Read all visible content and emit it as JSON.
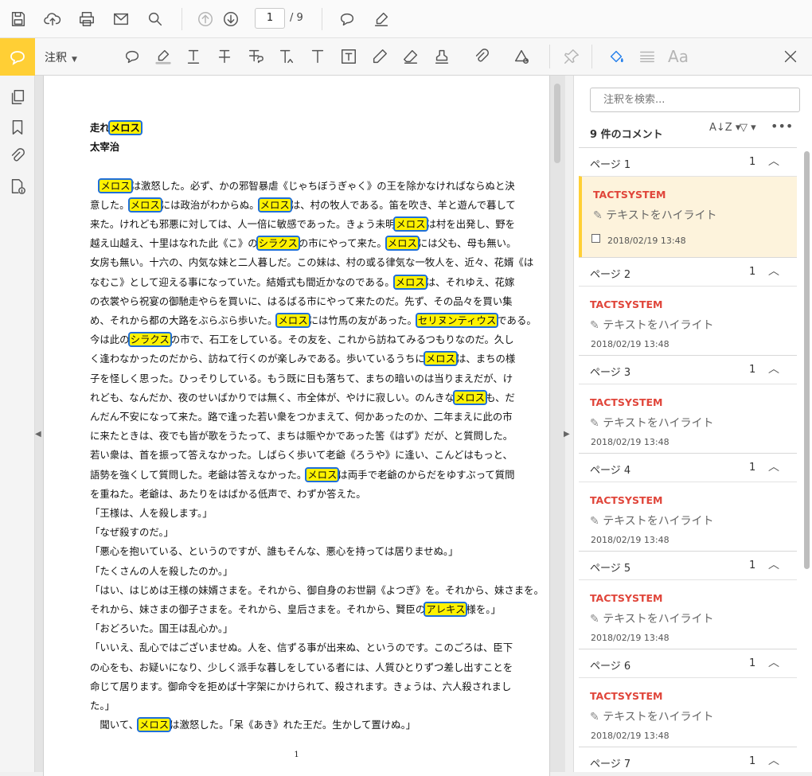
{
  "toolbar": {
    "page_current": "1",
    "page_total": "/ 9",
    "icons": [
      "save-icon",
      "upload-icon",
      "print-icon",
      "email-icon",
      "search-icon",
      "prev-page-icon",
      "next-page-icon",
      "comment-icon",
      "sign-icon"
    ]
  },
  "annot_toolbar": {
    "label": "注釈",
    "icons": [
      "sticky-note-icon",
      "highlight-icon",
      "underline-icon",
      "strikethrough-icon",
      "replace-text-icon",
      "insert-text-icon",
      "add-text-icon",
      "textbox-icon",
      "pencil-icon",
      "eraser-icon",
      "stamp-icon",
      "attach-icon",
      "shapes-icon",
      "pin-icon",
      "fill-color-icon",
      "line-weight-icon"
    ],
    "font_label": "Aa"
  },
  "document": {
    "title_lines": [
      {
        "before": "走れ",
        "hl": "メロス",
        "after": ""
      },
      {
        "before": "太宰治",
        "hl": "",
        "after": ""
      }
    ],
    "page_number": "1"
  },
  "right_panel": {
    "search_placeholder": "注釈を検索...",
    "comment_count": "9 件のコメント",
    "groups": [
      {
        "title": "ページ 1",
        "count": "1",
        "author": "TACTSYSTEM",
        "action": "テキストをハイライト",
        "date": "2018/02/19 13:48",
        "selected": true
      },
      {
        "title": "ページ 2",
        "count": "1",
        "author": "TACTSYSTEM",
        "action": "テキストをハイライト",
        "date": "2018/02/19 13:48",
        "selected": false
      },
      {
        "title": "ページ 3",
        "count": "1",
        "author": "TACTSYSTEM",
        "action": "テキストをハイライト",
        "date": "2018/02/19 13:48",
        "selected": false
      },
      {
        "title": "ページ 4",
        "count": "1",
        "author": "TACTSYSTEM",
        "action": "テキストをハイライト",
        "date": "2018/02/19 13:48",
        "selected": false
      },
      {
        "title": "ページ 5",
        "count": "1",
        "author": "TACTSYSTEM",
        "action": "テキストをハイライト",
        "date": "2018/02/19 13:48",
        "selected": false
      },
      {
        "title": "ページ 6",
        "count": "1",
        "author": "TACTSYSTEM",
        "action": "テキストをハイライト",
        "date": "2018/02/19 13:48",
        "selected": false
      },
      {
        "title": "ページ 7",
        "count": "1",
        "author": "",
        "action": "",
        "date": "",
        "selected": false
      }
    ]
  },
  "body_lines": [
    {
      "cls": "p",
      "segs": [
        [
          "　",
          ""
        ],
        [
          "メロス",
          "hl"
        ],
        [
          "は激怒した。必ず、かの邪智暴虐《じゃちぼうぎゃく》の王を除かなければならぬと決",
          ""
        ]
      ]
    },
    {
      "cls": "p",
      "segs": [
        [
          "意した。",
          ""
        ],
        [
          "メロス",
          "hl"
        ],
        [
          "には政治がわからぬ。",
          ""
        ],
        [
          "メロス",
          "hl"
        ],
        [
          "は、村の牧人である。笛を吹き、羊と遊んで暮して",
          ""
        ]
      ]
    },
    {
      "cls": "p",
      "segs": [
        [
          "来た。けれども邪悪に対しては、人一倍に敏感であった。きょう未明",
          ""
        ],
        [
          "メロス",
          "hl"
        ],
        [
          "は村を出発し、野を",
          ""
        ]
      ]
    },
    {
      "cls": "p",
      "segs": [
        [
          "越え山越え、十里はなれた此《こ》の",
          ""
        ],
        [
          "シラクス",
          "hl"
        ],
        [
          "の市にやって来た。",
          ""
        ],
        [
          "メロス",
          "hl"
        ],
        [
          "には父も、母も無い。",
          ""
        ]
      ]
    },
    {
      "cls": "p",
      "segs": [
        [
          "女房も無い。十六の、内気な妹と二人暮しだ。この妹は、村の或る律気な一牧人を、近々、花婿《は",
          ""
        ]
      ]
    },
    {
      "cls": "p",
      "segs": [
        [
          "なむこ》として迎える事になっていた。結婚式も間近かなのである。",
          ""
        ],
        [
          "メロス",
          "hl"
        ],
        [
          "は、それゆえ、花嫁",
          ""
        ]
      ]
    },
    {
      "cls": "p",
      "segs": [
        [
          "の衣裳やら祝宴の御馳走やらを買いに、はるばる市にやって来たのだ。先ず、その品々を買い集",
          ""
        ]
      ]
    },
    {
      "cls": "p",
      "segs": [
        [
          "め、それから都の大路をぶらぶら歩いた。",
          ""
        ],
        [
          "メロス",
          "hl"
        ],
        [
          "には竹馬の友があった。",
          ""
        ],
        [
          "セリヌンティウス",
          "hl"
        ],
        [
          "である。",
          ""
        ]
      ]
    },
    {
      "cls": "p",
      "segs": [
        [
          "今は此の",
          ""
        ],
        [
          "シラクス",
          "hl"
        ],
        [
          "の市で、石工をしている。その友を、これから訪ねてみるつもりなのだ。久し",
          ""
        ]
      ]
    },
    {
      "cls": "p",
      "segs": [
        [
          "く逢わなかったのだから、訪ねて行くのが楽しみである。歩いているうちに",
          ""
        ],
        [
          "メロス",
          "hl"
        ],
        [
          "は、まちの様",
          ""
        ]
      ]
    },
    {
      "cls": "p",
      "segs": [
        [
          "子を怪しく思った。ひっそりしている。もう既に日も落ちて、まちの暗いのは当りまえだが、け",
          ""
        ]
      ]
    },
    {
      "cls": "p",
      "segs": [
        [
          "れども、なんだか、夜のせいばかりでは無く、市全体が、やけに寂しい。のんきな",
          ""
        ],
        [
          "メロス",
          "hl"
        ],
        [
          "も、だ",
          ""
        ]
      ]
    },
    {
      "cls": "p",
      "segs": [
        [
          "んだん不安になって来た。路で逢った若い衆をつかまえて、何かあったのか、二年まえに此の市",
          ""
        ]
      ]
    },
    {
      "cls": "p",
      "segs": [
        [
          "に来たときは、夜でも皆が歌をうたって、まちは賑やかであった筈《はず》だが、と質問した。",
          ""
        ]
      ]
    },
    {
      "cls": "p",
      "segs": [
        [
          "若い衆は、首を振って答えなかった。しばらく歩いて老爺《ろうや》に逢い、こんどはもっと、",
          ""
        ]
      ]
    },
    {
      "cls": "p",
      "segs": [
        [
          "語勢を強くして質問した。老爺は答えなかった。",
          ""
        ],
        [
          "メロス",
          "hl"
        ],
        [
          "は両手で老爺のからだをゆすぶって質問",
          ""
        ]
      ]
    },
    {
      "cls": "l",
      "segs": [
        [
          "を重ねた。老爺は、あたりをはばかる低声で、わずか答えた。",
          ""
        ]
      ]
    },
    {
      "cls": "l",
      "segs": [
        [
          "「王様は、人を殺します。」",
          ""
        ]
      ]
    },
    {
      "cls": "l",
      "segs": [
        [
          "「なぜ殺すのだ。」",
          ""
        ]
      ]
    },
    {
      "cls": "l",
      "segs": [
        [
          "「悪心を抱いている、というのですが、誰もそんな、悪心を持っては居りませぬ。」",
          ""
        ]
      ]
    },
    {
      "cls": "l",
      "segs": [
        [
          "「たくさんの人を殺したのか。」",
          ""
        ]
      ]
    },
    {
      "cls": "p",
      "segs": [
        [
          "「はい、はじめは王様の妹婿さまを。それから、御自身のお世嗣《よつぎ》を。それから、妹さまを。",
          ""
        ]
      ]
    },
    {
      "cls": "l",
      "segs": [
        [
          "それから、妹さまの御子さまを。それから、皇后さまを。それから、賢臣の",
          ""
        ],
        [
          "アレキス",
          "hl"
        ],
        [
          "様を。」",
          ""
        ]
      ]
    },
    {
      "cls": "l",
      "segs": [
        [
          "「おどろいた。国王は乱心か。」",
          ""
        ]
      ]
    },
    {
      "cls": "p",
      "segs": [
        [
          "「いいえ、乱心ではございませぬ。人を、信ずる事が出来ぬ、というのです。このごろは、臣下",
          ""
        ]
      ]
    },
    {
      "cls": "p",
      "segs": [
        [
          "の心をも、お疑いになり、少しく派手な暮しをしている者には、人質ひとりずつ差し出すことを",
          ""
        ]
      ]
    },
    {
      "cls": "p",
      "segs": [
        [
          "命じて居ります。御命令を拒めば十字架にかけられて、殺されます。きょうは、六人殺されまし",
          ""
        ]
      ]
    },
    {
      "cls": "l",
      "segs": [
        [
          "た。」",
          ""
        ]
      ]
    },
    {
      "cls": "l",
      "segs": [
        [
          "　聞いて、",
          ""
        ],
        [
          "メロス",
          "hl"
        ],
        [
          "は激怒した。「呆《あき》れた王だ。生かして置けぬ。」",
          ""
        ]
      ]
    }
  ]
}
